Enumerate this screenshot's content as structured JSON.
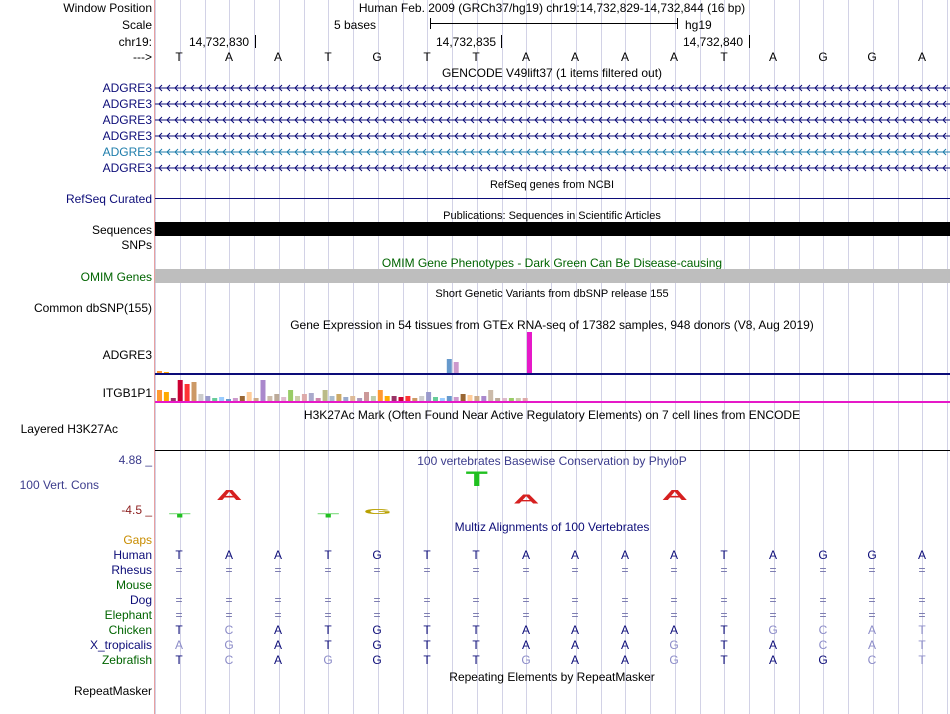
{
  "labels": {
    "window_position": "Window Position",
    "scale": "Scale",
    "chrom": "chr19:",
    "arrow": "--->",
    "adgre3": "ADGRE3",
    "refseq": "RefSeq Curated",
    "sequences": "Sequences",
    "snps": "SNPs",
    "omim": "OMIM Genes",
    "dbsnp": "Common dbSNP(155)",
    "gtex_gene1": "ADGRE3",
    "gtex_gene2": "ITGB1P1",
    "h3k27ac": "Layered H3K27Ac",
    "cons_max": "4.88 _",
    "cons": "100 Vert. Cons",
    "cons_min": "-4.5 _",
    "gaps": "Gaps",
    "species": [
      "Human",
      "Rhesus",
      "Mouse",
      "Dog",
      "Elephant",
      "Chicken",
      "X_tropicalis",
      "Zebrafish"
    ],
    "repeatmasker": "RepeatMasker"
  },
  "header": {
    "position": "Human Feb. 2009 (GRCh37/hg19)   chr19:14,732,829-14,732,844 (16 bp)",
    "scale_text": "5 bases",
    "assembly": "hg19",
    "ticks": [
      "14,732,830",
      "14,732,835",
      "14,732,840"
    ]
  },
  "bases": [
    "T",
    "A",
    "A",
    "T",
    "G",
    "T",
    "T",
    "A",
    "A",
    "A",
    "A",
    "T",
    "A",
    "G",
    "G",
    "A"
  ],
  "track_titles": {
    "gencode": "GENCODE V49lift37 (1 items filtered out)",
    "refseq": "RefSeq genes from NCBI",
    "publications": "Publications: Sequences in Scientific Articles",
    "omim": "OMIM Gene Phenotypes - Dark Green Can Be Disease-causing",
    "dbsnp": "Short Genetic Variants from dbSNP release 155",
    "gtex": "Gene Expression in 54 tissues from GTEx RNA-seq of 17382 samples, 948 donors (V8, Aug 2019)",
    "h3k27ac": "H3K27Ac Mark (Often Found Near Active Regulatory Elements) on 7 cell lines from ENCODE",
    "phylop": "100 vertebrates Basewise Conservation by PhyloP",
    "multiz": "Multiz Alignments of 100 Vertebrates",
    "repeatmasker": "Repeating Elements by RepeatMasker"
  },
  "alignment": {
    "Rhesus": [
      "=",
      "=",
      "=",
      "=",
      "=",
      "=",
      "=",
      "=",
      "=",
      "=",
      "=",
      "=",
      "=",
      "=",
      "=",
      "="
    ],
    "Mouse": [
      "",
      "",
      "",
      "",
      "",
      "",
      "",
      "",
      "",
      "",
      "",
      "",
      "",
      "",
      "",
      ""
    ],
    "Dog": [
      "=",
      "=",
      "=",
      "=",
      "=",
      "=",
      "=",
      "=",
      "=",
      "=",
      "=",
      "=",
      "=",
      "=",
      "=",
      "="
    ],
    "Elephant": [
      "=",
      "=",
      "=",
      "=",
      "=",
      "=",
      "=",
      "=",
      "=",
      "=",
      "=",
      "=",
      "=",
      "=",
      "=",
      "="
    ],
    "Chicken": [
      "T",
      "C",
      "A",
      "T",
      "G",
      "T",
      "T",
      "A",
      "A",
      "A",
      "A",
      "T",
      "G",
      "C",
      "A",
      "T"
    ],
    "X_tropicalis": [
      "A",
      "G",
      "A",
      "T",
      "G",
      "T",
      "T",
      "A",
      "A",
      "A",
      "G",
      "T",
      "A",
      "C",
      "A",
      "T"
    ],
    "Zebrafish": [
      "T",
      "C",
      "A",
      "G",
      "G",
      "T",
      "T",
      "G",
      "A",
      "A",
      "G",
      "T",
      "A",
      "G",
      "C",
      "T"
    ]
  },
  "colors": {
    "label_navy": "#0c0c78",
    "omim_green": "#006400",
    "gaps_orange": "#c88c00",
    "gtex_adgre3_line": "#0c0c78",
    "gtex_itgb1p1_line": "#e619c8"
  }
}
